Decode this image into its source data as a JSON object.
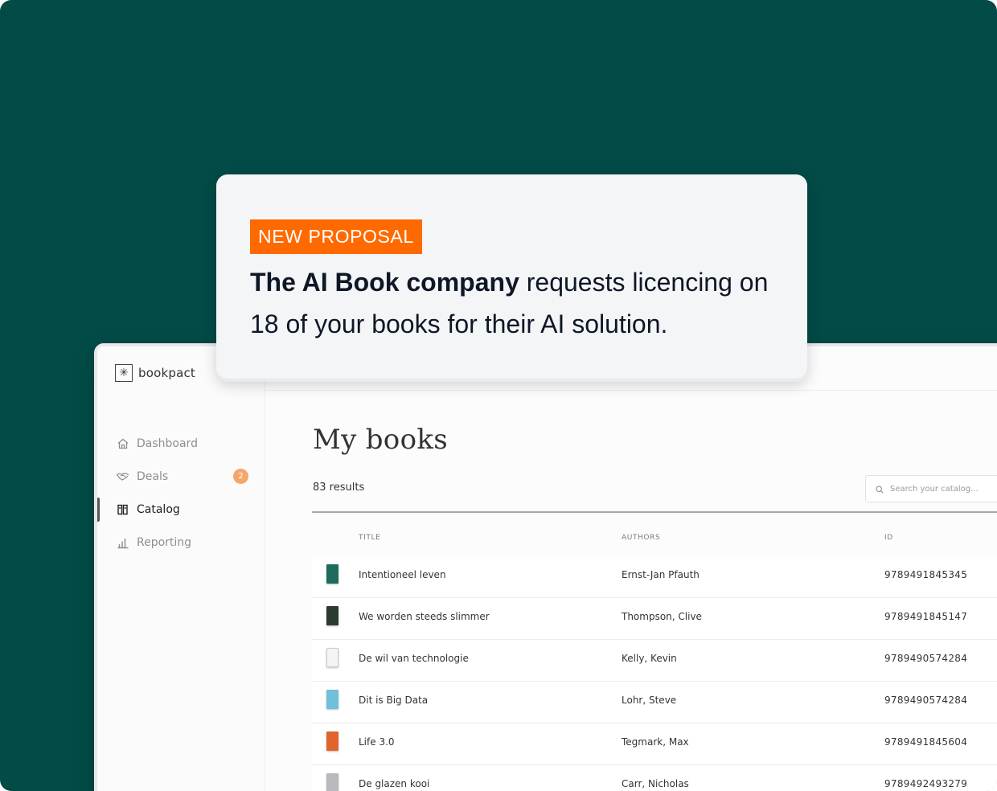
{
  "app": {
    "brand": "bookpact"
  },
  "sidebar": {
    "items": [
      {
        "label": "Dashboard",
        "icon": "home-icon",
        "active": false
      },
      {
        "label": "Deals",
        "icon": "handshake-icon",
        "active": false,
        "badge": "2"
      },
      {
        "label": "Catalog",
        "icon": "books-icon",
        "active": true
      },
      {
        "label": "Reporting",
        "icon": "bar-chart-icon",
        "active": false
      }
    ]
  },
  "main": {
    "title": "My books",
    "results": "83 results",
    "search": {
      "placeholder": "Search your catalog..."
    },
    "columns": {
      "title": "TITLE",
      "authors": "AUTHORS",
      "id": "ID"
    },
    "rows": [
      {
        "title": "Intentioneel leven",
        "authors": "Ernst-Jan Pfauth",
        "id": "9789491845345",
        "cover_color": "#1f6b5c"
      },
      {
        "title": "We worden steeds slimmer",
        "authors": "Thompson, Clive",
        "id": "9789491845147",
        "cover_color": "#2d3a2f"
      },
      {
        "title": "De wil van technologie",
        "authors": "Kelly, Kevin",
        "id": "9789490574284",
        "cover_color": "#f4f4f4"
      },
      {
        "title": "Dit is Big Data",
        "authors": "Lohr, Steve",
        "id": "9789490574284",
        "cover_color": "#6fc0d8"
      },
      {
        "title": "Life 3.0",
        "authors": "Tegmark, Max",
        "id": "9789491845604",
        "cover_color": "#e0642c"
      },
      {
        "title": "De glazen kooi",
        "authors": "Carr, Nicholas",
        "id": "9789492493279",
        "cover_color": "#b9b9bd"
      }
    ]
  },
  "proposal": {
    "tag": "NEW PROPOSAL",
    "company": "The AI Book company",
    "message": " requests licencing on 18 of your books for their AI solution."
  },
  "colors": {
    "background": "#024b47",
    "tag": "#ff6a00",
    "badge": "#f5a66b"
  }
}
